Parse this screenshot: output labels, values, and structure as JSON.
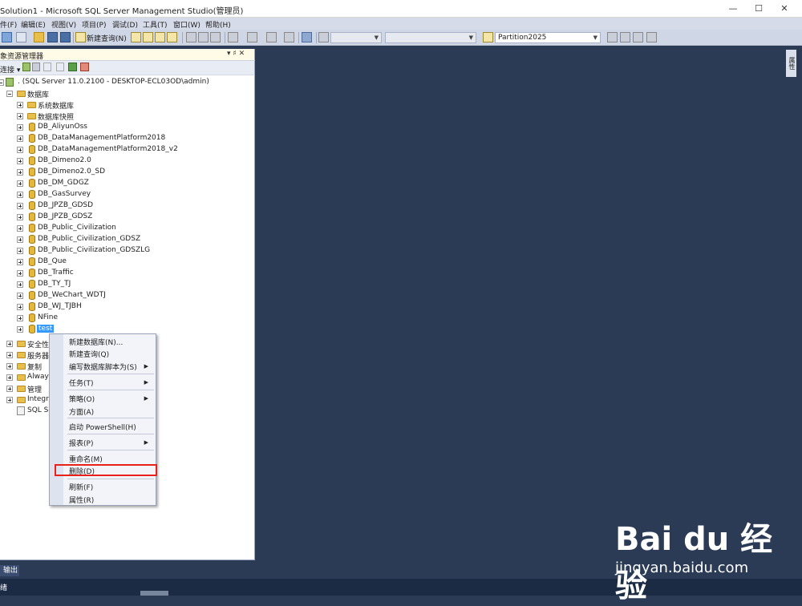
{
  "window": {
    "title": "Solution1 - Microsoft SQL Server Management Studio(管理员)",
    "minimize": "—",
    "maximize": "☐",
    "close": "✕"
  },
  "menu": {
    "items": [
      "件(F)",
      "编辑(E)",
      "视图(V)",
      "项目(P)",
      "调试(D)",
      "工具(T)",
      "窗口(W)",
      "帮助(H)"
    ]
  },
  "toolbar": {
    "new_query_label": "新建查询(N)",
    "database_combo": "Partition2025"
  },
  "object_explorer": {
    "title": "象资源管理器",
    "pin": "▾ ♯ ✕",
    "connect_label": "连接 ▾",
    "server": ". (SQL Server 11.0.2100 - DESKTOP-ECL03OD\\admin)",
    "databases_folder": "数据库",
    "system_db": "系统数据库",
    "snapshots": "数据库快照",
    "databases": [
      "DB_AliyunOss",
      "DB_DataManagementPlatform2018",
      "DB_DataManagementPlatform2018_v2",
      "DB_Dimeno2.0",
      "DB_Dimeno2.0_SD",
      "DB_DM_GDGZ",
      "DB_GasSurvey",
      "DB_JPZB_GDSD",
      "DB_JPZB_GDSZ",
      "DB_Public_Civilization",
      "DB_Public_Civilization_GDSZ",
      "DB_Public_Civilization_GDSZLG",
      "DB_Que",
      "DB_Traffic",
      "DB_TY_TJ",
      "DB_WeChart_WDTJ",
      "DB_WJ_TJBH",
      "NFine",
      "test"
    ],
    "other_folders": [
      "安全性",
      "服务器",
      "复制",
      "Always",
      "管理",
      "Integra"
    ],
    "agent": "SQL Se"
  },
  "context_menu": {
    "items": [
      "新建数据库(N)...",
      "新建查询(Q)",
      "编写数据库脚本为(S)",
      "任务(T)",
      "策略(O)",
      "方面(A)",
      "启动 PowerShell(H)",
      "报表(P)",
      "重命名(M)",
      "删除(D)",
      "刷新(F)",
      "属性(R)"
    ],
    "submenu_arrow": "▶"
  },
  "bottom": {
    "output_tab": "输出",
    "status": "绪"
  },
  "right_panel": {
    "tab": "属性"
  },
  "watermark": {
    "brand": "Bai du 经验",
    "url": "jingyan.baidu.com"
  },
  "colors": {
    "workspace": "#2b3a55",
    "selection": "#3399ff",
    "highlight_box": "#e8221b"
  }
}
